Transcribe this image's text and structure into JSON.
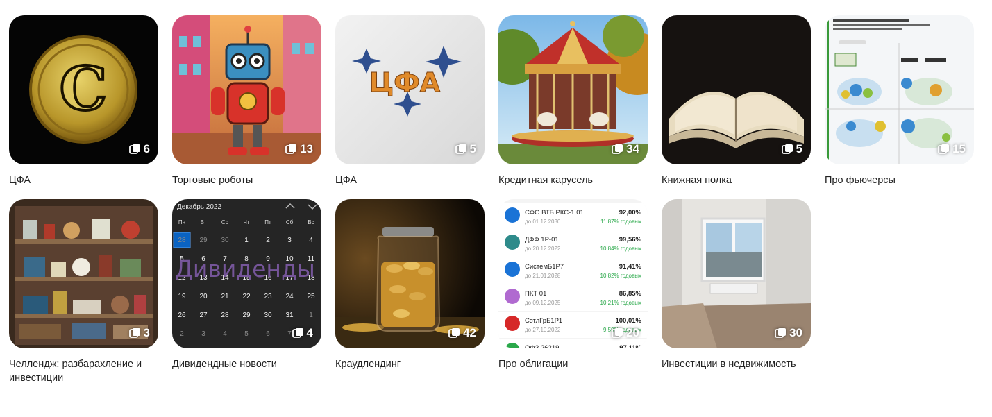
{
  "collections": [
    {
      "title": "ЦФА",
      "count": "6",
      "thumb_icon": "gold-coin-image",
      "thumb_text": "C"
    },
    {
      "title": "Торговые роботы",
      "count": "13",
      "thumb_icon": "robot-image"
    },
    {
      "title": "ЦФА",
      "count": "5",
      "thumb_icon": "cfa-stars-image",
      "thumb_text": "ЦФА"
    },
    {
      "title": "Кредитная карусель",
      "count": "34",
      "thumb_icon": "carousel-image"
    },
    {
      "title": "Книжная полка",
      "count": "5",
      "thumb_icon": "open-book-image"
    },
    {
      "title": "Про фьючерсы",
      "count": "15",
      "thumb_icon": "infographic-image"
    },
    {
      "title": "Челлендж: разбарахление и инвестиции",
      "count": "3",
      "thumb_icon": "cluttered-shelf-image"
    },
    {
      "title": "Дивидендные новости",
      "count": "4",
      "thumb_icon": "calendar-image",
      "calendar": {
        "month": "Декабрь 2022",
        "overlay": "Дивиденды",
        "weekdays": [
          "Пн",
          "Вт",
          "Ср",
          "Чт",
          "Пт",
          "Сб",
          "Вс"
        ],
        "rows": [
          [
            "28",
            "29",
            "30",
            "1",
            "2",
            "3",
            "4"
          ],
          [
            "5",
            "6",
            "7",
            "8",
            "9",
            "10",
            "11"
          ],
          [
            "12",
            "13",
            "14",
            "15",
            "16",
            "17",
            "18"
          ],
          [
            "19",
            "20",
            "21",
            "22",
            "23",
            "24",
            "25"
          ],
          [
            "26",
            "27",
            "28",
            "29",
            "30",
            "31",
            "1"
          ],
          [
            "2",
            "3",
            "4",
            "5",
            "6",
            "7",
            "8"
          ]
        ]
      }
    },
    {
      "title": "Краудлендинг",
      "count": "42",
      "thumb_icon": "coin-jar-image"
    },
    {
      "title": "Про облигации",
      "count": "20",
      "thumb_icon": "bonds-list-image",
      "bonds": [
        {
          "name": "СФО ВТБ РКС-1 01",
          "date": "до 01.12.2030",
          "price": "92,00%",
          "yield": "11,87% годовых",
          "color": "#1a73d6"
        },
        {
          "name": "ДФФ 1Р-01",
          "date": "до 20.12.2022",
          "price": "99,56%",
          "yield": "10,84% годовых",
          "color": "#2e8b8b"
        },
        {
          "name": "СистемБ1Р7",
          "date": "до 21.01.2028",
          "price": "91,41%",
          "yield": "10,82% годовых",
          "color": "#1a73d6"
        },
        {
          "name": "ПКТ 01",
          "date": "до 09.12.2025",
          "price": "86,85%",
          "yield": "10,21% годовых",
          "color": "#b06ad0"
        },
        {
          "name": "СэтлГрБ1Р1",
          "date": "до 27.10.2022",
          "price": "100,01%",
          "yield": "9,59% годовых",
          "color": "#d62828"
        },
        {
          "name": "ОФЗ 26219",
          "date": "",
          "price": "97,11%",
          "yield": "",
          "color": "#2aa84a"
        }
      ]
    },
    {
      "title": "Инвестиции в недвижимость",
      "count": "30",
      "thumb_icon": "empty-room-image"
    }
  ]
}
